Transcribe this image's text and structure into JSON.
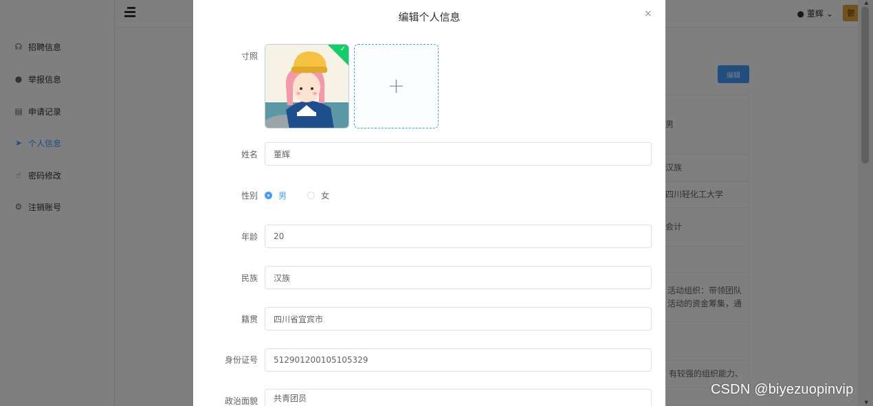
{
  "sidebar": {
    "items": [
      {
        "label": "招聘信息",
        "icon": "headset-icon",
        "glyph": "☊",
        "active": false
      },
      {
        "label": "举报信息",
        "icon": "user-icon",
        "glyph": "●",
        "active": false
      },
      {
        "label": "申请记录",
        "icon": "document-icon",
        "glyph": "▤",
        "active": false
      },
      {
        "label": "个人信息",
        "icon": "send-icon",
        "glyph": "➤",
        "active": true
      },
      {
        "label": "密码修改",
        "icon": "thumb-icon",
        "glyph": "☝",
        "active": false
      },
      {
        "label": "注销账号",
        "icon": "gear-icon",
        "glyph": "⚙",
        "active": false
      }
    ]
  },
  "header": {
    "user_name": "董辉",
    "user_icon": "user-icon",
    "dropdown_icon": "chevron-down-icon",
    "avatar_text": "鬱"
  },
  "background": {
    "edit_button": "编辑",
    "table_cells": [
      "男",
      "汉族",
      "四川轻化工大学",
      "会计",
      "",
      "活动组织：带领团队活动的资金筹集，通",
      "",
      "有较强的组织能力、"
    ]
  },
  "dialog": {
    "title": "编辑个人信息",
    "close_icon": "×",
    "photo_label": "寸照",
    "upload_plus": "+",
    "check_icon": "✓",
    "fields": {
      "name": {
        "label": "姓名",
        "value": "董辉"
      },
      "gender": {
        "label": "性别",
        "options": [
          "男",
          "女"
        ],
        "selected": "男"
      },
      "age": {
        "label": "年龄",
        "value": "20"
      },
      "ethnicity": {
        "label": "民族",
        "value": "汉族"
      },
      "hometown": {
        "label": "籍贯",
        "value": "四川省宜宾市"
      },
      "id_number": {
        "label": "身份证号",
        "value": "512901200105105329"
      },
      "political_status": {
        "label": "政治面貌",
        "value": "共青团员"
      }
    }
  },
  "watermark": "CSDN @biyezuopinvip",
  "colors": {
    "accent": "#409eff",
    "success": "#13ce66",
    "overlay": "rgba(0,0,0,0.5)"
  }
}
